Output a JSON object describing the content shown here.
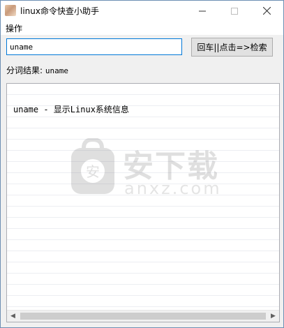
{
  "window": {
    "title": "linux命令快查小助手",
    "controls": {
      "minimize": "—",
      "maximize": "☐",
      "close": "✕"
    }
  },
  "menu": {
    "items": [
      "操作"
    ]
  },
  "search": {
    "value": "uname",
    "button_label": "回车||点击=>检索"
  },
  "segmentation": {
    "label": "分词结果:",
    "value": "uname"
  },
  "result": {
    "lines": [
      "uname - 显示Linux系统信息"
    ]
  },
  "watermark": {
    "text": "安下载",
    "sub": "anxz.com",
    "shield_glyph": "安"
  },
  "scrollbar": {
    "left_arrow": "◀",
    "right_arrow": "▶"
  }
}
